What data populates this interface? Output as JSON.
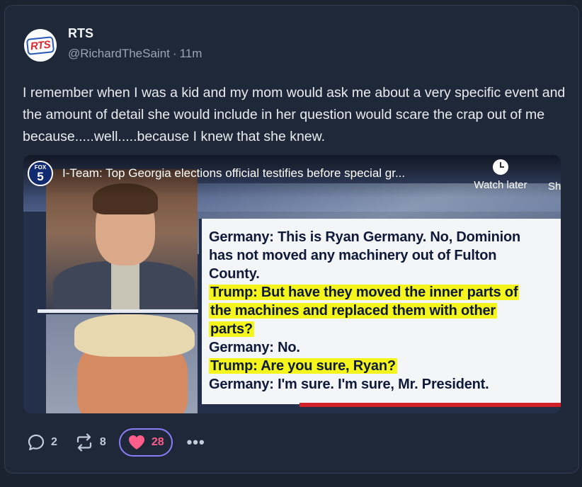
{
  "post": {
    "author_name": "RTS",
    "avatar_text": "RTS",
    "handle": "@RichardTheSaint",
    "separator": "·",
    "time": "11m",
    "text": "I remember when I was a kid and my mom would ask me about a very specific event and the amount of detail she would include in her question would scare the crap out of me because.....well.....because I knew that she knew."
  },
  "media": {
    "logo_top": "FOX",
    "logo_number": "5",
    "video_title": "I-Team: Top Georgia elections official testifies before special gr...",
    "watch_later_label": "Watch later",
    "share_label_partial": "Sh",
    "quote_lines": [
      "Germany: This is Ryan Germany. No, Dominion",
      "has not moved any machinery out of Fulton",
      "County.",
      "Trump: But have they moved the inner parts of",
      "the machines and replaced them with other",
      "parts?",
      "Germany: No.",
      "Trump: Are you sure, Ryan?",
      "Germany: I'm sure. I'm sure, Mr. President."
    ],
    "highlight_color": "#f3f51c"
  },
  "actions": {
    "replies": "2",
    "reposts": "8",
    "likes": "28",
    "like_color": "#ff5e8a",
    "more": "•••"
  }
}
